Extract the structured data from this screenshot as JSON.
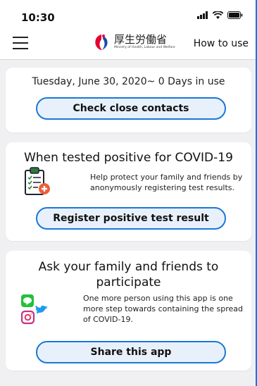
{
  "status": {
    "time": "10:30"
  },
  "nav": {
    "logo_main": "厚生労働省",
    "logo_sub": "Ministry of Health, Labour and Welfare",
    "how_to_use": "How to use"
  },
  "card_contacts": {
    "date_line": "Tuesday, June 30, 2020~ 0 Days in use",
    "button": "Check close contacts"
  },
  "card_positive": {
    "title": "When tested positive for COVID-19",
    "description": "Help protect your family and friends by anonymously registering test results.",
    "button": "Register positive test result"
  },
  "card_share": {
    "title": "Ask your family and friends to participate",
    "description": "One more person using this app is one more step towards containing the spread of COVID-19.",
    "button": "Share this app"
  },
  "colors": {
    "accent": "#1a78d6",
    "pill_bg": "#e8f1fb",
    "background": "#f0f0f2"
  }
}
